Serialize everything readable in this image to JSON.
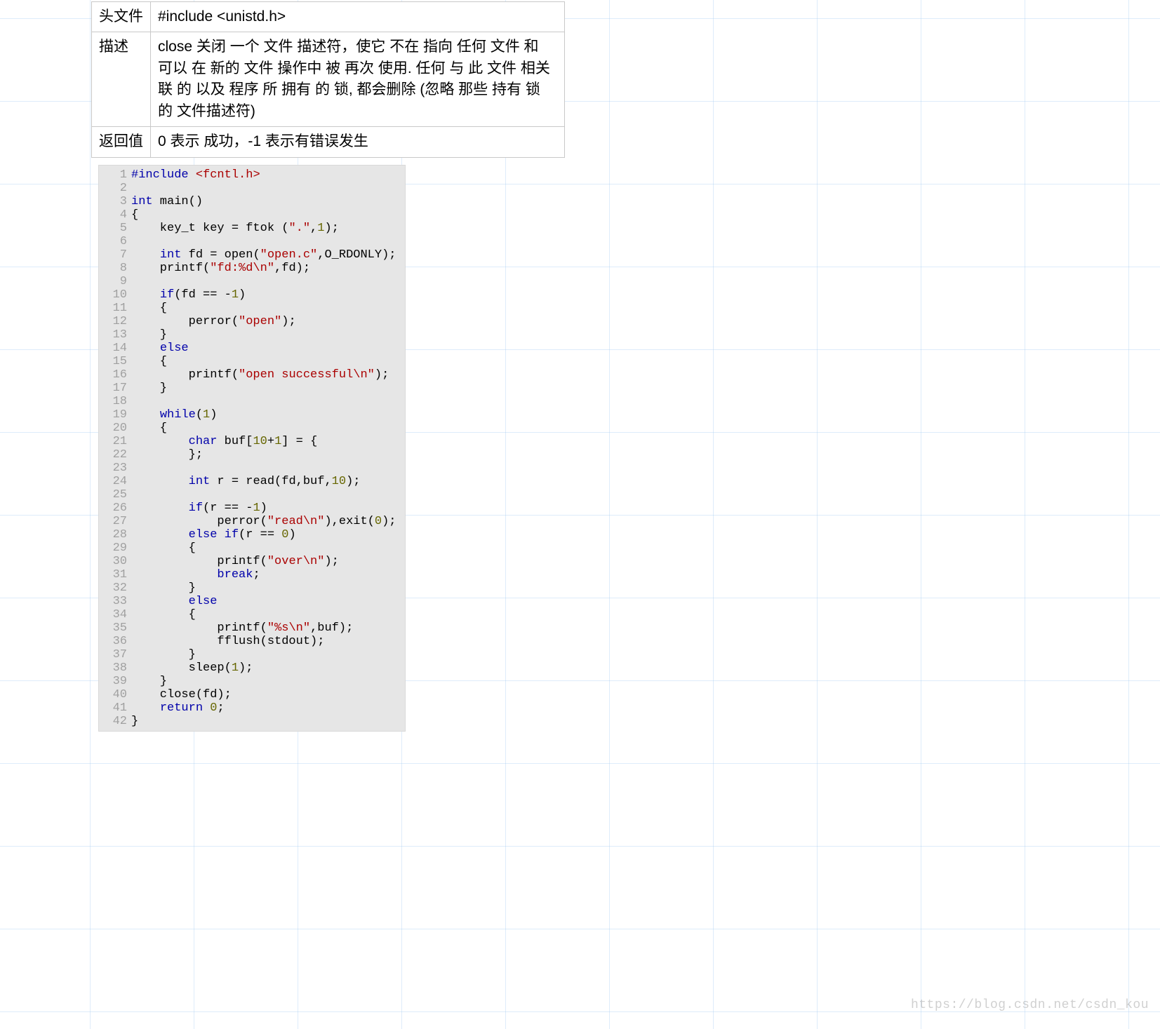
{
  "table": {
    "row0": {
      "label": "头文件",
      "value": "#include <unistd.h>"
    },
    "row1": {
      "label": "描述",
      "value": "close 关闭 一个 文件 描述符，使它 不在 指向 任何 文件 和 可以 在 新的 文件 操作中 被 再次 使用.  任何 与 此 文件 相关联 的 以及 程序 所 拥有 的 锁, 都会删除 (忽略 那些 持有 锁 的 文件描述符)"
    },
    "row2": {
      "label": "返回值",
      "value": "0 表示 成功，-1 表示有错误发生"
    }
  },
  "code": {
    "lines": [
      {
        "n": "1",
        "segs": [
          [
            "pp",
            "#include "
          ],
          [
            "hdr",
            "<fcntl.h>"
          ]
        ]
      },
      {
        "n": "2",
        "segs": []
      },
      {
        "n": "3",
        "segs": [
          [
            "type",
            "int"
          ],
          [
            "",
            " main()"
          ]
        ]
      },
      {
        "n": "4",
        "segs": [
          [
            "",
            "{"
          ]
        ]
      },
      {
        "n": "5",
        "segs": [
          [
            "",
            "    key_t key = ftok ("
          ],
          [
            "str",
            "\".\""
          ],
          [
            "",
            ","
          ],
          [
            "num",
            "1"
          ],
          [
            "",
            ");"
          ]
        ]
      },
      {
        "n": "6",
        "segs": []
      },
      {
        "n": "7",
        "segs": [
          [
            "",
            "    "
          ],
          [
            "type",
            "int"
          ],
          [
            "",
            " fd = open("
          ],
          [
            "str",
            "\"open.c\""
          ],
          [
            "",
            ",O_RDONLY);"
          ]
        ]
      },
      {
        "n": "8",
        "segs": [
          [
            "",
            "    printf("
          ],
          [
            "str",
            "\"fd:%d\\n\""
          ],
          [
            "",
            ",fd);"
          ]
        ]
      },
      {
        "n": "9",
        "segs": []
      },
      {
        "n": "10",
        "segs": [
          [
            "",
            "    "
          ],
          [
            "kw",
            "if"
          ],
          [
            "",
            "(fd == -"
          ],
          [
            "num",
            "1"
          ],
          [
            "",
            ")"
          ]
        ]
      },
      {
        "n": "11",
        "segs": [
          [
            "",
            "    {"
          ]
        ]
      },
      {
        "n": "12",
        "segs": [
          [
            "",
            "        perror("
          ],
          [
            "str",
            "\"open\""
          ],
          [
            "",
            ");"
          ]
        ]
      },
      {
        "n": "13",
        "segs": [
          [
            "",
            "    }"
          ]
        ]
      },
      {
        "n": "14",
        "segs": [
          [
            "",
            "    "
          ],
          [
            "kw",
            "else"
          ]
        ]
      },
      {
        "n": "15",
        "segs": [
          [
            "",
            "    {"
          ]
        ]
      },
      {
        "n": "16",
        "segs": [
          [
            "",
            "        printf("
          ],
          [
            "str",
            "\"open successful\\n\""
          ],
          [
            "",
            ");"
          ]
        ]
      },
      {
        "n": "17",
        "segs": [
          [
            "",
            "    }"
          ]
        ]
      },
      {
        "n": "18",
        "segs": []
      },
      {
        "n": "19",
        "segs": [
          [
            "",
            "    "
          ],
          [
            "kw",
            "while"
          ],
          [
            "",
            "("
          ],
          [
            "num",
            "1"
          ],
          [
            "",
            ")"
          ]
        ]
      },
      {
        "n": "20",
        "segs": [
          [
            "",
            "    {"
          ]
        ]
      },
      {
        "n": "21",
        "segs": [
          [
            "",
            "        "
          ],
          [
            "type",
            "char"
          ],
          [
            "",
            " buf["
          ],
          [
            "num",
            "10"
          ],
          [
            "",
            "+"
          ],
          [
            "num",
            "1"
          ],
          [
            "",
            "] = {"
          ]
        ]
      },
      {
        "n": "22",
        "segs": [
          [
            "",
            "        };"
          ]
        ]
      },
      {
        "n": "23",
        "segs": []
      },
      {
        "n": "24",
        "segs": [
          [
            "",
            "        "
          ],
          [
            "type",
            "int"
          ],
          [
            "",
            " r = read(fd,buf,"
          ],
          [
            "num",
            "10"
          ],
          [
            "",
            ");"
          ]
        ]
      },
      {
        "n": "25",
        "segs": []
      },
      {
        "n": "26",
        "segs": [
          [
            "",
            "        "
          ],
          [
            "kw",
            "if"
          ],
          [
            "",
            "(r == -"
          ],
          [
            "num",
            "1"
          ],
          [
            "",
            ")"
          ]
        ]
      },
      {
        "n": "27",
        "segs": [
          [
            "",
            "            perror("
          ],
          [
            "str",
            "\"read\\n\""
          ],
          [
            "",
            "),exit("
          ],
          [
            "num",
            "0"
          ],
          [
            "",
            ");"
          ]
        ]
      },
      {
        "n": "28",
        "segs": [
          [
            "",
            "        "
          ],
          [
            "kw",
            "else"
          ],
          [
            "",
            " "
          ],
          [
            "kw",
            "if"
          ],
          [
            "",
            "(r == "
          ],
          [
            "num",
            "0"
          ],
          [
            "",
            ")"
          ]
        ]
      },
      {
        "n": "29",
        "segs": [
          [
            "",
            "        {"
          ]
        ]
      },
      {
        "n": "30",
        "segs": [
          [
            "",
            "            printf("
          ],
          [
            "str",
            "\"over\\n\""
          ],
          [
            "",
            ");"
          ]
        ]
      },
      {
        "n": "31",
        "segs": [
          [
            "",
            "            "
          ],
          [
            "kw",
            "break"
          ],
          [
            "",
            ";"
          ]
        ]
      },
      {
        "n": "32",
        "segs": [
          [
            "",
            "        }"
          ]
        ]
      },
      {
        "n": "33",
        "segs": [
          [
            "",
            "        "
          ],
          [
            "kw",
            "else"
          ]
        ]
      },
      {
        "n": "34",
        "segs": [
          [
            "",
            "        {"
          ]
        ]
      },
      {
        "n": "35",
        "segs": [
          [
            "",
            "            printf("
          ],
          [
            "str",
            "\"%s\\n\""
          ],
          [
            "",
            ",buf);"
          ]
        ]
      },
      {
        "n": "36",
        "segs": [
          [
            "",
            "            fflush(stdout);"
          ]
        ]
      },
      {
        "n": "37",
        "segs": [
          [
            "",
            "        }"
          ]
        ]
      },
      {
        "n": "38",
        "segs": [
          [
            "",
            "        sleep("
          ],
          [
            "num",
            "1"
          ],
          [
            "",
            ");"
          ]
        ]
      },
      {
        "n": "39",
        "segs": [
          [
            "",
            "    }"
          ]
        ]
      },
      {
        "n": "40",
        "segs": [
          [
            "",
            "    close(fd);"
          ]
        ]
      },
      {
        "n": "41",
        "segs": [
          [
            "",
            "    "
          ],
          [
            "kw",
            "return"
          ],
          [
            "",
            " "
          ],
          [
            "num",
            "0"
          ],
          [
            "",
            ";"
          ]
        ]
      },
      {
        "n": "42",
        "segs": [
          [
            "",
            "}"
          ]
        ]
      }
    ]
  },
  "watermark": "https://blog.csdn.net/csdn_kou"
}
